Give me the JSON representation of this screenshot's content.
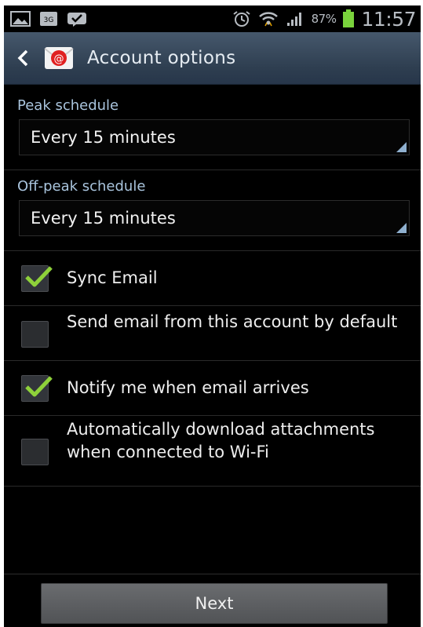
{
  "status_bar": {
    "icons": [
      "image-icon",
      "3g-icon",
      "check-bubble-icon",
      "alarm-icon",
      "wifi-icon",
      "signal-icon",
      "battery-icon"
    ],
    "battery_percent": "87%",
    "time": "11:57"
  },
  "action_bar": {
    "title": "Account options",
    "app_icon": "email-app-icon"
  },
  "peak": {
    "label": "Peak schedule",
    "value": "Every 15 minutes"
  },
  "offpeak": {
    "label": "Off-peak schedule",
    "value": "Every 15 minutes"
  },
  "options": [
    {
      "label": "Sync Email",
      "checked": true
    },
    {
      "label": "Send email from this account by default",
      "checked": false
    },
    {
      "label": "Notify me when email arrives",
      "checked": true
    },
    {
      "label": "Automatically download attachments when connected to Wi-Fi",
      "checked": false
    }
  ],
  "next_label": "Next",
  "colors": {
    "accent_check": "#8ed13a",
    "section_label": "#a9c4dd",
    "action_bar": "#3a4b5e",
    "battery": "#7ad33c"
  }
}
